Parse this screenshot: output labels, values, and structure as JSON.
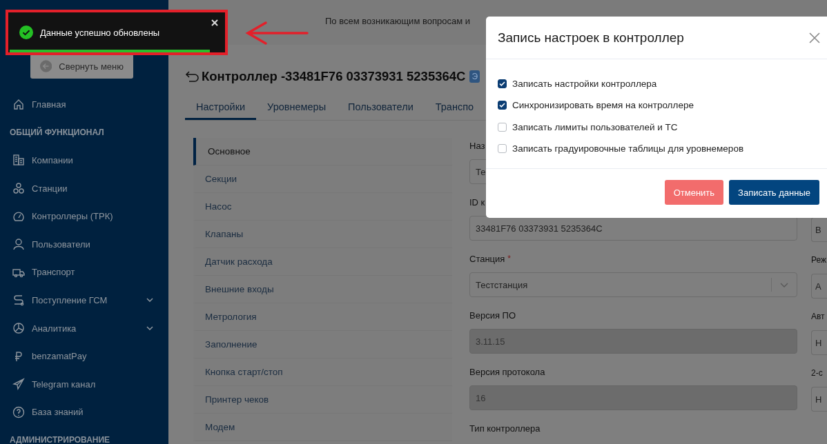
{
  "notice_bar": {
    "text": "По всем возникающим вопросам и"
  },
  "toast": {
    "message": "Данные успешно обновлены",
    "level": 0.96
  },
  "sidebar": {
    "collapse_button": "Свернуть меню",
    "items": [
      {
        "kind": "link",
        "label": "Главная"
      },
      {
        "kind": "section",
        "label": "ОБЩИЙ ФУНКЦИОНАЛ"
      },
      {
        "kind": "link",
        "label": "Компании"
      },
      {
        "kind": "link",
        "label": "Станции"
      },
      {
        "kind": "link",
        "label": "Контроллеры (ТРК)"
      },
      {
        "kind": "link",
        "label": "Пользователи"
      },
      {
        "kind": "link",
        "label": "Транспорт"
      },
      {
        "kind": "group",
        "label": "Поступление ГСМ"
      },
      {
        "kind": "group",
        "label": "Аналитика"
      },
      {
        "kind": "link",
        "label": "benzamatPay"
      },
      {
        "kind": "link",
        "label": "Telegram канал"
      },
      {
        "kind": "link",
        "label": "База знаний"
      },
      {
        "kind": "section",
        "label": "АДМИНИСТРИРОВАНИЕ"
      }
    ]
  },
  "page": {
    "title": "Контроллер -33481F76 03373931 5235364C",
    "badge": "Э",
    "tabs": [
      {
        "label": "Настройки",
        "selected": true
      },
      {
        "label": "Уровнемеры",
        "selected": false
      },
      {
        "label": "Пользователи",
        "selected": false
      },
      {
        "label": "Транспо",
        "selected": false
      }
    ]
  },
  "settings_menu": [
    {
      "label": "Основное",
      "selected": true
    },
    {
      "label": "Секции",
      "selected": false
    },
    {
      "label": "Насос",
      "selected": false
    },
    {
      "label": "Клапаны",
      "selected": false
    },
    {
      "label": "Датчик расхода",
      "selected": false
    },
    {
      "label": "Внешние входы",
      "selected": false
    },
    {
      "label": "Метрология",
      "selected": false
    },
    {
      "label": "Заполнение",
      "selected": false
    },
    {
      "label": "Кнопка старт/стоп",
      "selected": false
    },
    {
      "label": "Принтер чеков",
      "selected": false
    },
    {
      "label": "Модем",
      "selected": false
    }
  ],
  "form": {
    "fields": [
      {
        "kind": "text",
        "label": "Наз",
        "value": "Те",
        "disabled": false
      },
      {
        "kind": "text",
        "label": "ID к",
        "value": "33481F76 03373931 5235364C",
        "disabled": false
      },
      {
        "kind": "select",
        "label": "Станция",
        "required_mark": "*",
        "value": "Тестстанция",
        "disabled": false
      },
      {
        "kind": "text",
        "label": "Версия ПО",
        "value": "3.11.15",
        "disabled": true
      },
      {
        "kind": "text",
        "label": "Версия протокола",
        "value": "16",
        "disabled": true
      },
      {
        "kind": "label",
        "label": "Тип контроллера"
      }
    ]
  },
  "form_right": {
    "fields": [
      {
        "kind": "text",
        "value": "В",
        "disabled": false
      },
      {
        "kind": "text",
        "label": "Реж",
        "value": "А",
        "disabled": false
      },
      {
        "kind": "text",
        "label": "Авт",
        "value": "Н",
        "disabled": false
      },
      {
        "kind": "text",
        "label": "2-с",
        "value": "Н",
        "disabled": false
      }
    ]
  },
  "dialog": {
    "title": "Запись настроек в контроллер",
    "options": [
      {
        "label": "Записать настройки контроллера",
        "checked": true
      },
      {
        "label": "Синхронизировать время на контроллере",
        "checked": true
      },
      {
        "label": "Записать лимиты пользователей и ТС",
        "checked": false
      },
      {
        "label": "Записать градуировочные таблицы для уровнемеров",
        "checked": false
      }
    ],
    "buttons": [
      {
        "kind": "cancel",
        "label": "Отменить"
      },
      {
        "kind": "primary",
        "label": "Записать данные"
      }
    ]
  }
}
